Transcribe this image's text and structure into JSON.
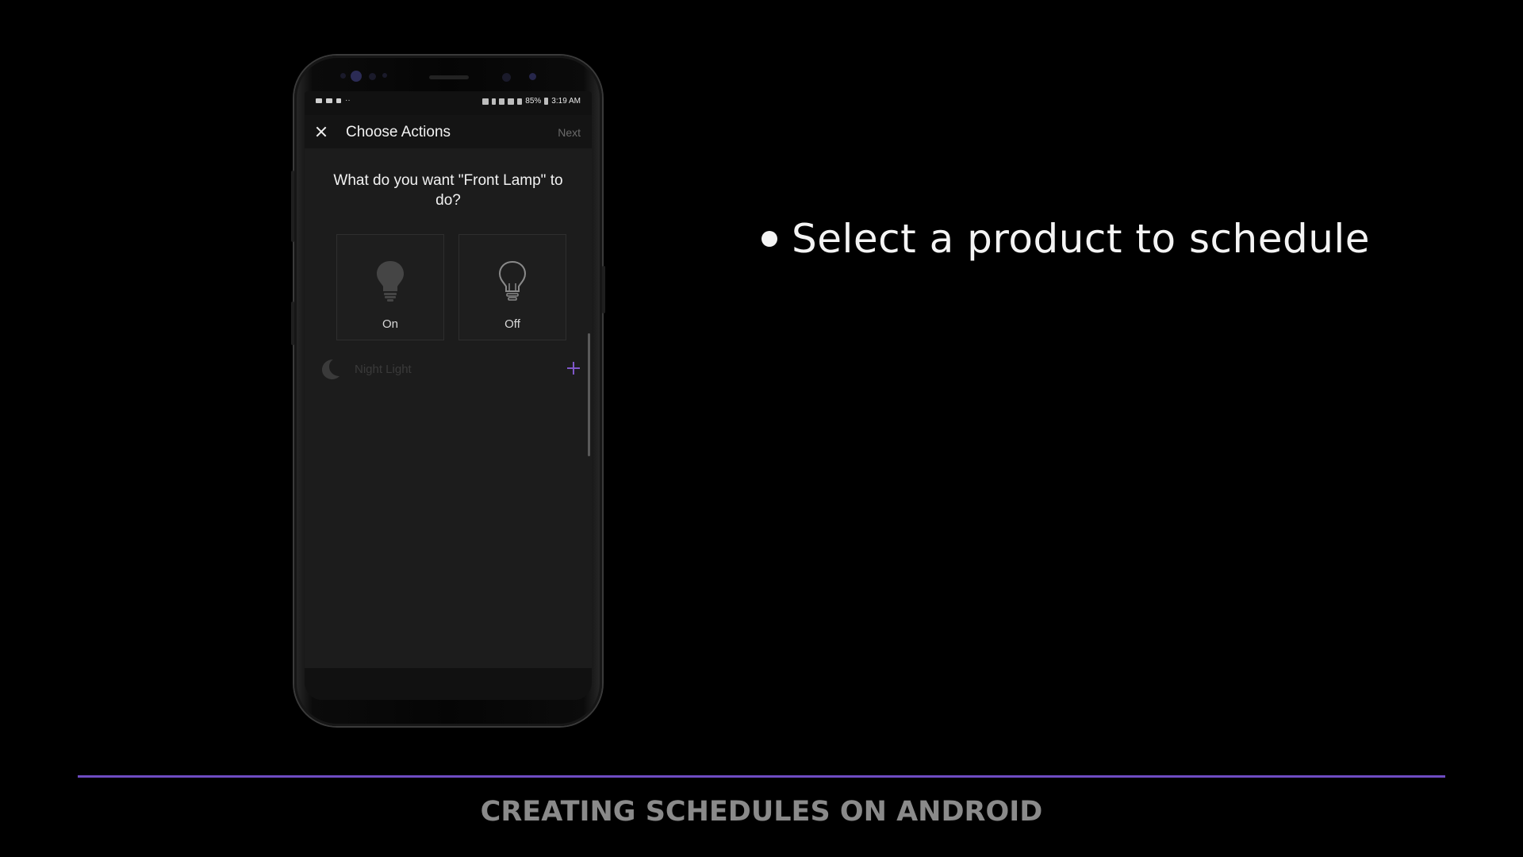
{
  "phone": {
    "status_bar": {
      "battery": "85%",
      "time": "3:19 AM"
    },
    "app_bar": {
      "title": "Choose Actions",
      "next_label": "Next"
    },
    "question": "What do you want \"Front Lamp\" to do?",
    "actions": [
      {
        "label": "On",
        "icon": "bulb-on-icon"
      },
      {
        "label": "Off",
        "icon": "bulb-off-icon"
      }
    ],
    "night_light": {
      "label": "Night Light",
      "icon": "moon-icon",
      "add_icon": "plus-icon"
    }
  },
  "slide": {
    "bullets": [
      "Select a product to schedule"
    ],
    "footer_title": "CREATING SCHEDULES ON ANDROID"
  },
  "colors": {
    "background": "#000000",
    "accent": "#6e4cc2",
    "plus": "#7f57c9",
    "screen": "#1c1c1c"
  }
}
